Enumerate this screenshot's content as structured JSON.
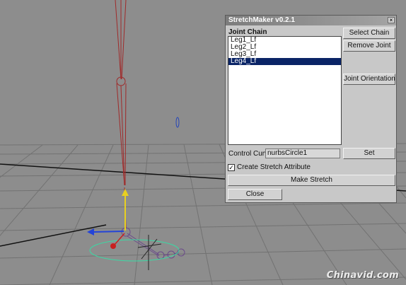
{
  "dialog": {
    "title": "StretchMaker v0.2.1",
    "close_glyph": "×",
    "joint_chain_label": "Joint Chain",
    "joints": [
      {
        "name": "Leg1_Lf",
        "selected": false
      },
      {
        "name": "Leg2_Lf",
        "selected": false
      },
      {
        "name": "Leg3_Lf",
        "selected": false
      },
      {
        "name": "Leg4_Lf",
        "selected": true
      }
    ],
    "buttons": {
      "select_chain": "Select Chain",
      "remove_joint": "Remove Joint",
      "joint_orientation": "Joint Orientation",
      "set": "Set",
      "make_stretch": "Make Stretch",
      "close": "Close"
    },
    "control_curve": {
      "label": "Control Curve:",
      "value": "nurbsCircle1"
    },
    "stretch_attribute": {
      "label": "Create Stretch Attribute",
      "checked": true,
      "check_glyph": "✓"
    }
  },
  "viewport": {
    "background_color": "#8d8d8d",
    "grid_color": "#6e6e6e",
    "axis_line_color": "#111111",
    "joint_color": "#a02a2a",
    "curve_color": "#3cd8a4"
  },
  "watermark": "Chinavid.com"
}
